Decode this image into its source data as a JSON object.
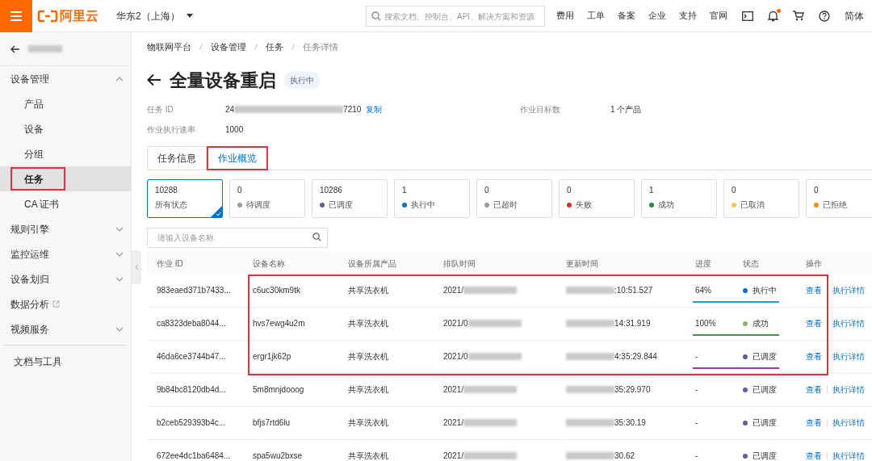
{
  "topbar": {
    "logo_text": "阿里云",
    "region": "华东2（上海）",
    "search": {
      "placeholder": "搜索文档、控制台、API、解决方案和资源"
    },
    "nav": [
      "费用",
      "工单",
      "备案",
      "企业",
      "支持",
      "官网"
    ],
    "notification_dot": true,
    "language": "简体"
  },
  "sidebar": {
    "items": [
      {
        "label": "设备管理",
        "expanded": true,
        "selected": false,
        "children": [
          {
            "label": "产品",
            "selected": false
          },
          {
            "label": "设备",
            "selected": false
          },
          {
            "label": "分组",
            "selected": false
          },
          {
            "label": "任务",
            "selected": true
          },
          {
            "label": "CA 证书",
            "selected": false
          }
        ]
      },
      {
        "label": "规则引擎",
        "expanded": false,
        "selected": false
      },
      {
        "label": "监控运维",
        "expanded": false,
        "selected": false
      },
      {
        "label": "设备划归",
        "expanded": false,
        "selected": false
      },
      {
        "label": "数据分析",
        "kind": "external",
        "selected": false
      },
      {
        "label": "视频服务",
        "expanded": false,
        "selected": false
      },
      {
        "label": "文档与工具",
        "kind": "footer",
        "selected": false
      }
    ]
  },
  "breadcrumb": [
    "物联网平台",
    "设备管理",
    "任务",
    "任务详情"
  ],
  "title": "全量设备重启",
  "status_badge": "执行中",
  "info": [
    {
      "label": "任务 ID",
      "value_start": "24",
      "value_end": "7210",
      "link": "复制"
    },
    {
      "label": "作业目标数",
      "value": "1 个产品"
    },
    {
      "label": "作业执行速率",
      "value": "1000"
    }
  ],
  "tabs": [
    {
      "label": "任务信息",
      "selected": false
    },
    {
      "label": "作业概览",
      "selected": true
    }
  ],
  "status_cards": [
    {
      "count": "10288",
      "label": "所有状态",
      "selected": true
    },
    {
      "count": "0",
      "label": "待调度",
      "color": "#9a9a9a",
      "selected": false
    },
    {
      "count": "10286",
      "label": "已调度",
      "color": "#6b5b95",
      "selected": false
    },
    {
      "count": "1",
      "label": "执行中",
      "color": "#0070cc",
      "selected": false
    },
    {
      "count": "0",
      "label": "已超时",
      "color": "#9a9a9a",
      "selected": false
    },
    {
      "count": "0",
      "label": "失败",
      "color": "#d93026",
      "selected": false
    },
    {
      "count": "1",
      "label": "成功",
      "color": "#1e8e3e",
      "selected": false
    },
    {
      "count": "0",
      "label": "已取消",
      "color": "#ffc440",
      "selected": false
    },
    {
      "count": "0",
      "label": "已拒绝",
      "color": "#f98e1a",
      "selected": false
    }
  ],
  "device_search": {
    "placeholder": "请输入设备名称"
  },
  "table": {
    "columns": [
      "作业 ID",
      "设备名称",
      "设备所属产品",
      "排队时间",
      "更新时间",
      "进度",
      "状态",
      "操作"
    ],
    "rows": [
      {
        "id": "983eaed371b7433...",
        "device": "c6uc30km9tk",
        "product": "共享洗衣机",
        "queued": "2021/",
        "updated": ":10:51.527",
        "progress": "64%",
        "status": {
          "label": "执行中",
          "color": "#0070cc"
        },
        "annotation": {
          "color": "#2e9bd6"
        },
        "actions": [
          "查看",
          "执行详情"
        ]
      },
      {
        "id": "ca8323deba8044...",
        "device": "hvs7ewg4u2m",
        "product": "共享洗衣机",
        "queued": "2021/0",
        "updated": "14:31.919",
        "progress": "100%",
        "status": {
          "label": "成功",
          "color": "#8fb36a"
        },
        "annotation": {
          "color": "#27a843"
        },
        "actions": [
          "查看",
          "执行详情"
        ]
      },
      {
        "id": "46da6ce3744b47...",
        "device": "ergr1jk62p",
        "product": "共享洗衣机",
        "queued": "2021/0",
        "updated": "4:35:29.844",
        "progress": "-",
        "status": {
          "label": "已调度",
          "color": "#6b5b95"
        },
        "annotation": {
          "color": "#8e3fa8"
        },
        "actions": [
          "查看",
          "执行详情"
        ]
      },
      {
        "id": "9b84bc8120db4d...",
        "device": "5m8mnjdooog",
        "product": "共享洗衣机",
        "queued": "2021/",
        "updated": "35:29.970",
        "progress": "-",
        "status": {
          "label": "已调度",
          "color": "#6b5b95"
        },
        "actions": [
          "查看",
          "执行详情"
        ]
      },
      {
        "id": "b2ceb529393b4c...",
        "device": "bfjs7rtd6lu",
        "product": "共享洗衣机",
        "queued": "2021/",
        "updated": "35:30.19",
        "progress": "-",
        "status": {
          "label": "已调度",
          "color": "#6b5b95"
        },
        "actions": [
          "查看",
          "执行详情"
        ]
      },
      {
        "id": "672ee4dc1ba6484...",
        "device": "spa5wu2bxse",
        "product": "共享洗衣机",
        "queued": "2021/",
        "updated": "30.62",
        "progress": "-",
        "status": {
          "label": "已调度",
          "color": "#6b5b95"
        },
        "actions": [
          "查看",
          "执行详情"
        ]
      }
    ]
  }
}
